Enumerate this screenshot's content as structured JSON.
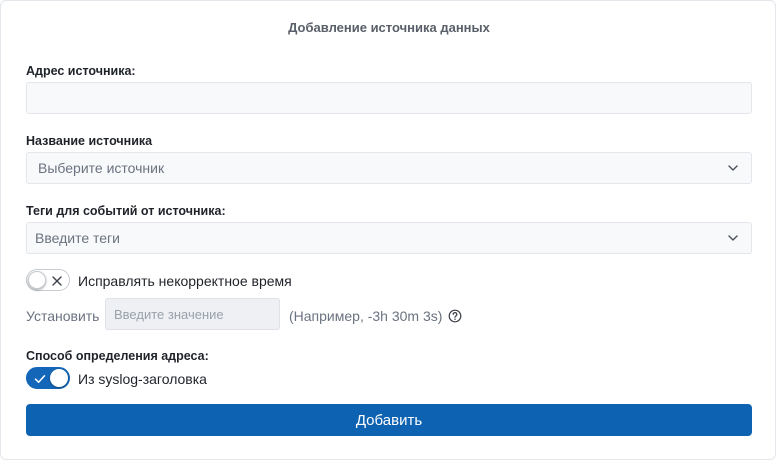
{
  "form": {
    "title": "Добавление источника данных",
    "address": {
      "label": "Адрес источника:",
      "value": ""
    },
    "source_name": {
      "label": "Название источника",
      "placeholder": "Выберите источник"
    },
    "tags": {
      "label": "Теги для событий от источника:",
      "placeholder": "Введите теги"
    },
    "fix_time": {
      "label": "Исправлять некорректное время",
      "enabled": false
    },
    "set": {
      "label": "Установить",
      "placeholder": "Введите значение",
      "hint": "(Например, -3h 30m 3s)"
    },
    "address_method": {
      "label": "Способ определения адреса:",
      "toggle_label": "Из syslog-заголовка",
      "enabled": true
    },
    "submit_label": "Добавить"
  },
  "colors": {
    "primary": "#0e62b2",
    "field_bg": "#f8f9fb",
    "border": "#e3e6ea"
  },
  "icons": {
    "dropdown": "chevron-down-icon",
    "toggle_off": "close-icon",
    "toggle_on": "check-icon",
    "help": "question-circle-icon"
  }
}
